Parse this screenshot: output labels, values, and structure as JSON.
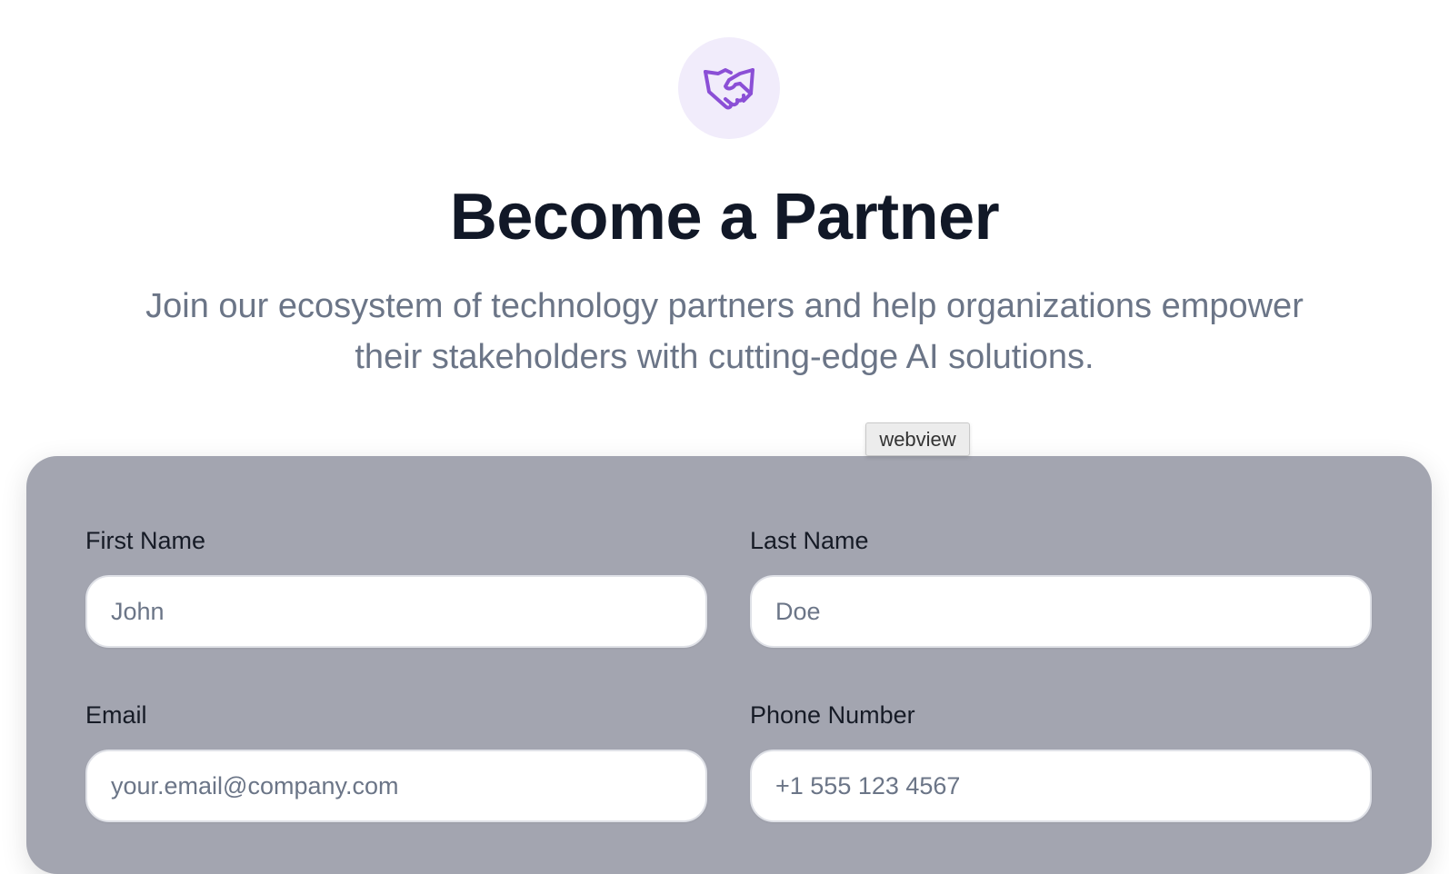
{
  "header": {
    "icon": "handshake-icon",
    "title": "Become a Partner",
    "subtitle": "Join our ecosystem of technology partners and help organizations empower their stakeholders with cutting-edge AI solutions."
  },
  "tooltip": {
    "text": "webview"
  },
  "form": {
    "first_name": {
      "label": "First Name",
      "placeholder": "John",
      "value": ""
    },
    "last_name": {
      "label": "Last Name",
      "placeholder": "Doe",
      "value": ""
    },
    "email": {
      "label": "Email",
      "placeholder": "your.email@company.com",
      "value": ""
    },
    "phone": {
      "label": "Phone Number",
      "placeholder": "+1 555 123 4567",
      "value": ""
    }
  },
  "colors": {
    "accent": "#8b4fd6",
    "icon_bg": "#f1ecfb",
    "title": "#111827",
    "subtitle": "#6b7587",
    "card_bg": "#a3a5b0"
  }
}
